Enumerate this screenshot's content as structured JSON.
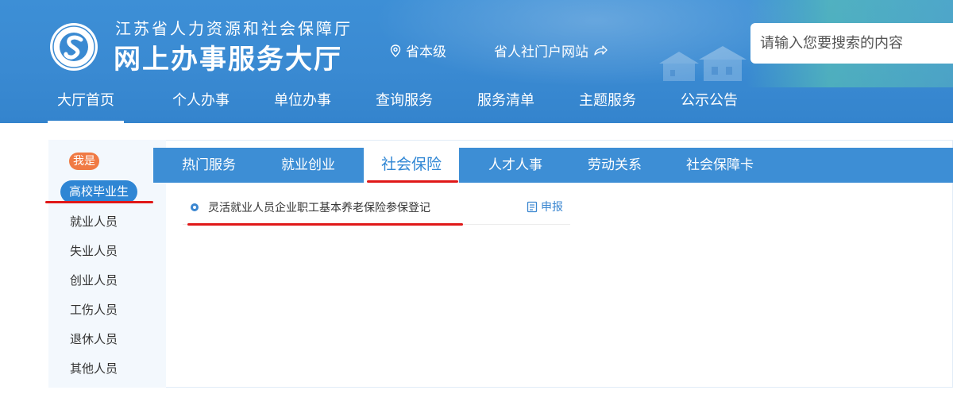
{
  "header": {
    "org_name": "江苏省人力资源和社会保障厅",
    "site_title": "网上办事服务大厅",
    "region_label": "省本级",
    "portal_label": "省人社门户网站",
    "search_placeholder": "请输入您要搜索的内容"
  },
  "nav": {
    "items": [
      {
        "label": "大厅首页",
        "active": true
      },
      {
        "label": "个人办事"
      },
      {
        "label": "单位办事"
      },
      {
        "label": "查询服务"
      },
      {
        "label": "服务清单"
      },
      {
        "label": "主题服务"
      },
      {
        "label": "公示公告"
      }
    ]
  },
  "roles": {
    "tag": "我是",
    "items": [
      {
        "label": "高校毕业生",
        "active": true
      },
      {
        "label": "就业人员"
      },
      {
        "label": "失业人员"
      },
      {
        "label": "创业人员"
      },
      {
        "label": "工伤人员"
      },
      {
        "label": "退休人员"
      },
      {
        "label": "其他人员"
      }
    ]
  },
  "tabs": {
    "items": [
      {
        "label": "热门服务"
      },
      {
        "label": "就业创业"
      },
      {
        "label": "社会保险",
        "active": true
      },
      {
        "label": "人才人事"
      },
      {
        "label": "劳动关系"
      },
      {
        "label": "社会保障卡"
      }
    ]
  },
  "services": [
    {
      "label": "灵活就业人员企业职工基本养老保险参保登记",
      "action": "申报"
    }
  ],
  "colors": {
    "header_blue": "#3a8ad2",
    "tab_bar_blue": "#3d8ed5",
    "accent_blue": "#2f86d4",
    "tag_orange": "#f07a44",
    "annotation_red": "#e01818"
  },
  "icons": {
    "logo": "social-security-logo",
    "region": "location-pin-icon",
    "portal": "external-link-icon",
    "bullet": "ring-bullet-icon",
    "apply": "document-icon"
  }
}
